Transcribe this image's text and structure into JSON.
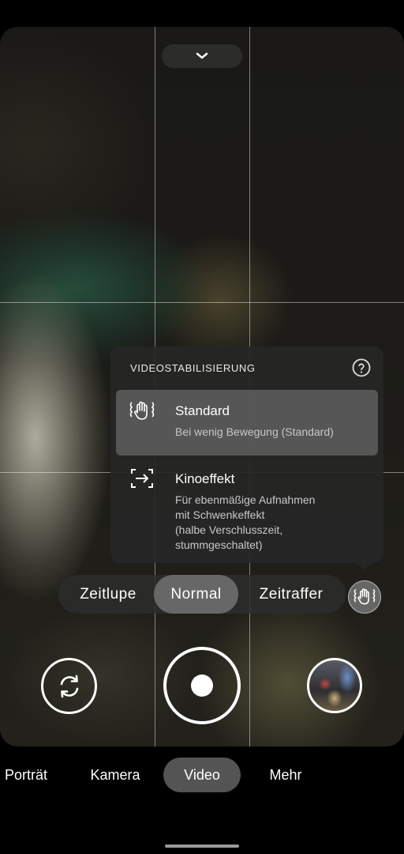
{
  "top": {
    "collapse_icon": "chevron-down-icon"
  },
  "stabilization": {
    "title": "VIDEOSTABILISIERUNG",
    "help_icon": "help-icon",
    "options": [
      {
        "icon": "hand-stabilization-icon",
        "title": "Standard",
        "description": "Bei wenig Bewegung (Standard)",
        "selected": true
      },
      {
        "icon": "cinematic-pan-icon",
        "title": "Kinoeffekt",
        "description_lines": [
          "Für ebenmäßige Aufnahmen",
          "mit Schwenkeffekt",
          "(halbe Verschlusszeit,",
          "stummgeschaltet)"
        ],
        "selected": false
      }
    ]
  },
  "speed": {
    "items": [
      "Zeitlupe",
      "Normal",
      "Zeitraffer"
    ],
    "active": "Normal",
    "stabilization_button_icon": "hand-stabilization-icon"
  },
  "controls": {
    "flip_icon": "switch-camera-icon",
    "shutter": "record-button",
    "gallery": "gallery-thumbnail"
  },
  "modes": {
    "items": [
      "Porträt",
      "Kamera",
      "Video",
      "Mehr"
    ],
    "active": "Video"
  }
}
